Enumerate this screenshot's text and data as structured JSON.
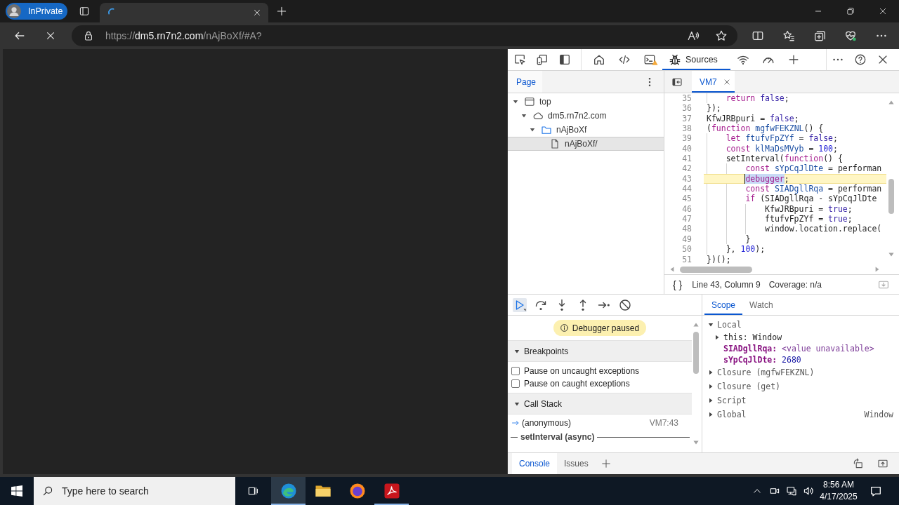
{
  "browser": {
    "profile": {
      "label": "InPrivate"
    },
    "loading": true,
    "address": {
      "url": [
        {
          "text": "https://",
          "emphasis": false
        },
        {
          "text": "dm5.rn7n2.com",
          "emphasis": true
        },
        {
          "text": "/nAjBoXf/#A?",
          "emphasis": false
        }
      ]
    }
  },
  "devtools": {
    "panel_tabs": [
      {
        "selected": false,
        "warning": false
      },
      {
        "selected": false,
        "warning": false
      },
      {
        "selected": false,
        "warning": true
      },
      {
        "label": "Sources",
        "selected": true,
        "warning": false
      },
      {
        "selected": false,
        "warning": false
      },
      {
        "selected": false,
        "warning": false
      }
    ],
    "navigator": {
      "tabs": [
        {
          "label": "Page",
          "selected": true
        }
      ],
      "tree": [
        {
          "kind": "frame",
          "label": "top",
          "expanded": true,
          "selected": false,
          "children": [
            {
              "kind": "domain",
              "label": "dm5.rn7n2.com",
              "expanded": true,
              "selected": false,
              "children": [
                {
                  "kind": "folder",
                  "label": "nAjBoXf",
                  "expanded": true,
                  "selected": false,
                  "children": [
                    {
                      "kind": "file",
                      "label": "nAjBoXf/",
                      "selected": true
                    }
                  ]
                }
              ]
            }
          ]
        }
      ]
    },
    "editor": {
      "tabs": [
        {
          "label": "VM7",
          "selected": true
        }
      ],
      "lines": [
        {
          "number": "35",
          "paused": false,
          "tokens": [
            {
              "kind": "keyword",
              "text": "    return "
            },
            {
              "kind": "atom",
              "text": "false"
            },
            {
              "kind": "text",
              "text": ";"
            }
          ]
        },
        {
          "number": "36",
          "paused": false,
          "tokens": [
            {
              "kind": "text",
              "text": "});"
            }
          ]
        },
        {
          "number": "37",
          "paused": false,
          "tokens": [
            {
              "kind": "text",
              "text": "KfwJRBpuri = "
            },
            {
              "kind": "atom",
              "text": "false"
            },
            {
              "kind": "text",
              "text": ";"
            }
          ]
        },
        {
          "number": "38",
          "paused": false,
          "tokens": [
            {
              "kind": "text",
              "text": "("
            },
            {
              "kind": "keyword",
              "text": "function "
            },
            {
              "kind": "definition",
              "text": "mgfwFEKZNL"
            },
            {
              "kind": "text",
              "text": "() {"
            }
          ]
        },
        {
          "number": "39",
          "paused": false,
          "tokens": [
            {
              "kind": "keyword",
              "text": "    let "
            },
            {
              "kind": "definition",
              "text": "ftufvFpZYf"
            },
            {
              "kind": "text",
              "text": " = "
            },
            {
              "kind": "atom",
              "text": "false"
            },
            {
              "kind": "text",
              "text": ";"
            }
          ]
        },
        {
          "number": "40",
          "paused": false,
          "tokens": [
            {
              "kind": "keyword",
              "text": "    const "
            },
            {
              "kind": "definition",
              "text": "klMaDsMVyb"
            },
            {
              "kind": "text",
              "text": " = "
            },
            {
              "kind": "number",
              "text": "100"
            },
            {
              "kind": "text",
              "text": ";"
            }
          ]
        },
        {
          "number": "41",
          "paused": false,
          "tokens": [
            {
              "kind": "text",
              "text": "    setInterval("
            },
            {
              "kind": "keyword",
              "text": "function"
            },
            {
              "kind": "text",
              "text": "() {"
            }
          ]
        },
        {
          "number": "42",
          "paused": false,
          "tokens": [
            {
              "kind": "keyword",
              "text": "        const "
            },
            {
              "kind": "definition",
              "text": "sYpCqJlDte"
            },
            {
              "kind": "text",
              "text": " = performan"
            }
          ]
        },
        {
          "number": "43",
          "paused": true,
          "tokens": [
            {
              "kind": "selection",
              "text": "        debugger"
            },
            {
              "kind": "text",
              "text": ";"
            }
          ]
        },
        {
          "number": "44",
          "paused": false,
          "tokens": [
            {
              "kind": "keyword",
              "text": "        const "
            },
            {
              "kind": "definition",
              "text": "SIADgllRqa"
            },
            {
              "kind": "text",
              "text": " = performan"
            }
          ]
        },
        {
          "number": "45",
          "paused": false,
          "tokens": [
            {
              "kind": "keyword",
              "text": "        if"
            },
            {
              "kind": "text",
              "text": " (SIADgllRqa - sYpCqJlDte"
            }
          ]
        },
        {
          "number": "46",
          "paused": false,
          "tokens": [
            {
              "kind": "text",
              "text": "            KfwJRBpuri = "
            },
            {
              "kind": "atom",
              "text": "true"
            },
            {
              "kind": "text",
              "text": ";"
            }
          ]
        },
        {
          "number": "47",
          "paused": false,
          "tokens": [
            {
              "kind": "text",
              "text": "            ftufvFpZYf = "
            },
            {
              "kind": "atom",
              "text": "true"
            },
            {
              "kind": "text",
              "text": ";"
            }
          ]
        },
        {
          "number": "48",
          "paused": false,
          "tokens": [
            {
              "kind": "text",
              "text": "            window.location.replace("
            }
          ]
        },
        {
          "number": "49",
          "paused": false,
          "tokens": [
            {
              "kind": "text",
              "text": "        }"
            }
          ]
        },
        {
          "number": "50",
          "paused": false,
          "tokens": [
            {
              "kind": "text",
              "text": "    }, "
            },
            {
              "kind": "number",
              "text": "100"
            },
            {
              "kind": "text",
              "text": ");"
            }
          ]
        },
        {
          "number": "51",
          "paused": false,
          "tokens": [
            {
              "kind": "text",
              "text": "})();"
            }
          ]
        }
      ],
      "status": {
        "format": "{ }",
        "position": "Line 43, Column 9",
        "coverage": "Coverage: n/a"
      }
    },
    "debugger": {
      "controls": [
        {
          "focused": true
        },
        {
          "focused": false
        },
        {
          "focused": false
        },
        {
          "focused": false
        },
        {
          "focused": false
        },
        {
          "focused": false
        }
      ],
      "notice": "Debugger paused",
      "sections": [
        {
          "kind": "checkboxes",
          "title": "Breakpoints",
          "expanded": true,
          "items": [
            {
              "label": "Pause on uncaught exceptions",
              "checked": false
            },
            {
              "label": "Pause on caught exceptions",
              "checked": false
            }
          ]
        },
        {
          "kind": "call_stack",
          "title": "Call Stack",
          "expanded": true,
          "frames": [
            {
              "name": "(anonymous)",
              "location": "VM7:43",
              "current": true
            }
          ],
          "async_label": "setInterval (async)"
        }
      ]
    },
    "sidebar": {
      "tabs": [
        {
          "label": "Scope",
          "selected": true
        },
        {
          "label": "Watch",
          "selected": false
        }
      ],
      "scope": [
        {
          "label": "Local",
          "expanded": true,
          "children": [
            {
              "kind": "object",
              "name": "this:",
              "value": "Window",
              "expanded": false
            },
            {
              "kind": "unavailable",
              "name": "SIADgllRqa:",
              "value": "<value unavailable>"
            },
            {
              "kind": "number",
              "name": "sYpCqJlDte:",
              "value": "2680"
            }
          ]
        },
        {
          "label": "Closure (mgfwFEKZNL)",
          "expanded": false
        },
        {
          "label": "Closure (get)",
          "expanded": false
        },
        {
          "label": "Script",
          "expanded": false
        },
        {
          "label": "Global",
          "expanded": false,
          "value": "Window"
        }
      ]
    },
    "drawer": {
      "tabs": [
        {
          "label": "Console",
          "selected": true
        },
        {
          "label": "Issues",
          "selected": false
        }
      ]
    }
  },
  "taskbar": {
    "search": {
      "placeholder": "Type here to search"
    },
    "apps": [
      {
        "running": true,
        "focused": true
      },
      {
        "running": false,
        "focused": false
      },
      {
        "running": false,
        "focused": false
      },
      {
        "running": true,
        "focused": false
      }
    ],
    "clock": {
      "time": "8:56 AM",
      "date": "4/17/2025"
    }
  }
}
